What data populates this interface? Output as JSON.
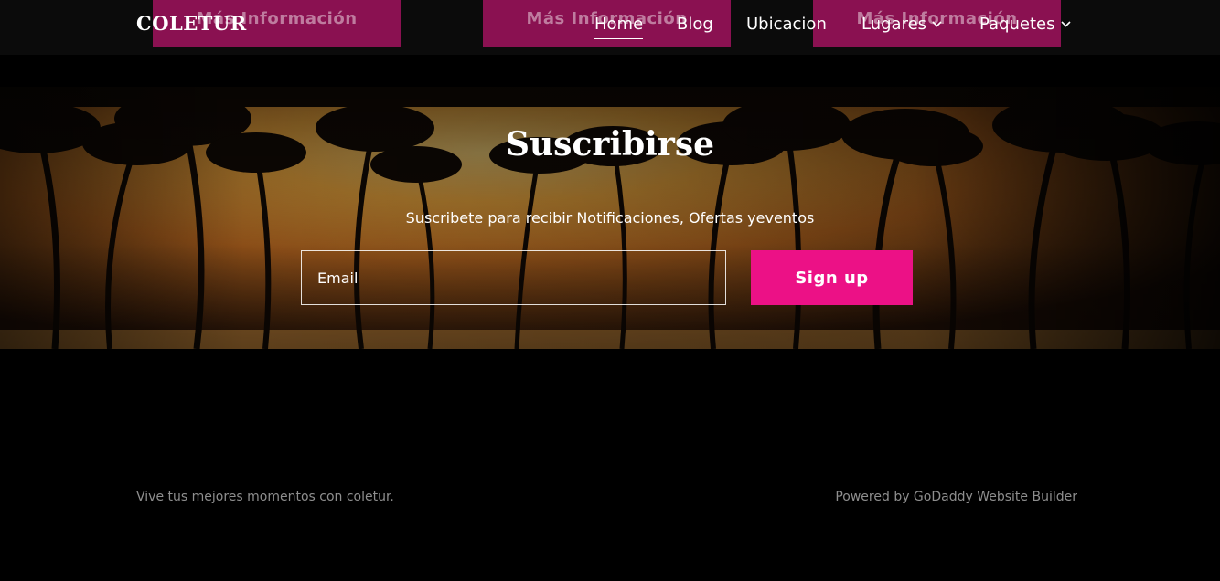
{
  "header": {
    "logo": "COLETUR",
    "background_buttons": [
      "Más Información",
      "Más Información",
      "Más Información"
    ],
    "nav": {
      "home": "Home",
      "blog": "Blog",
      "ubicacion": "Ubicacion",
      "lugares": "Lugares",
      "paquetes": "Paquetes"
    }
  },
  "subscribe": {
    "title": "Suscribirse",
    "subtitle": "Suscribete para recibir Notificaciones, Ofertas yeventos",
    "email_placeholder": "Email",
    "button_label": "Sign up"
  },
  "footer": {
    "tagline": "Vive tus mejores momentos con coletur.",
    "powered_by": "Powered by GoDaddy Website Builder"
  },
  "colors": {
    "accent": "#ec1186",
    "behind_button": "#8a1151",
    "background": "#000000"
  },
  "icons": {
    "nav_dropdown": "chevron-down-icon"
  }
}
